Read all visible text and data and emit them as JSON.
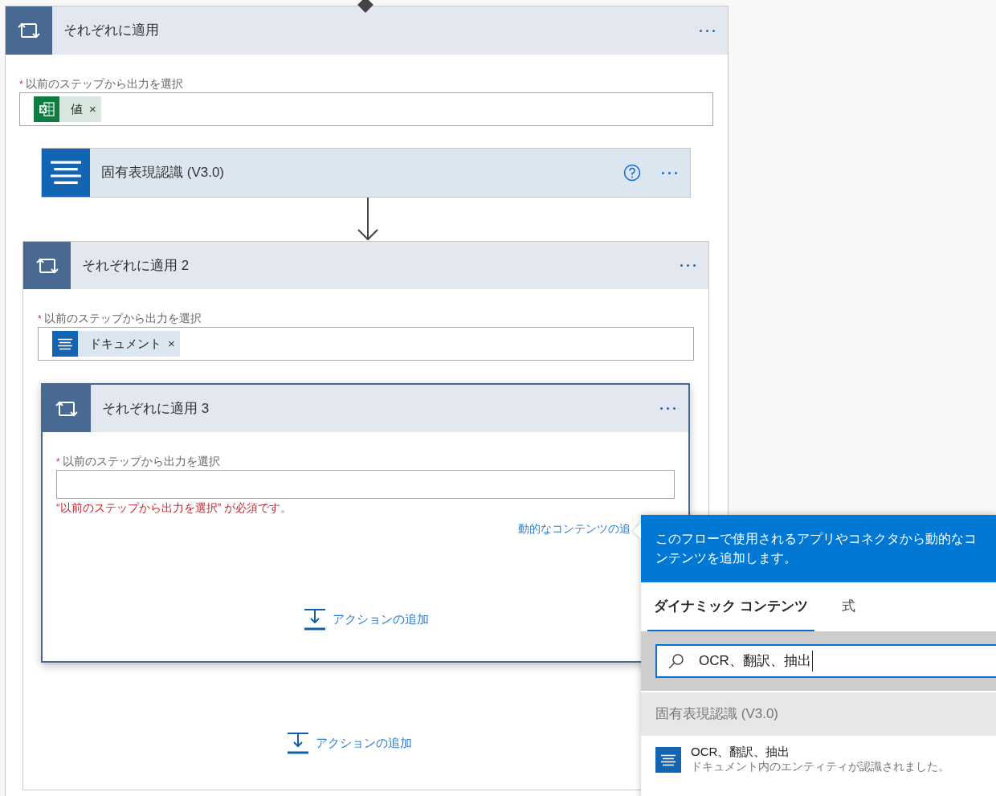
{
  "loop": {
    "title": "それぞれに適用",
    "field": {
      "required_mark": "*",
      "label": "以前のステップから出力を選択",
      "tokens": [
        {
          "kind": "excel",
          "label": "値",
          "remove": "×"
        }
      ]
    },
    "steps": [
      {
        "kind": "action",
        "title": "固有表現認識 (V3.0)"
      },
      {
        "kind": "loop",
        "title": "それぞれに適用 2",
        "field": {
          "required_mark": "*",
          "label": "以前のステップから出力を選択",
          "tokens": [
            {
              "kind": "text",
              "label": "ドキュメント",
              "remove": "×"
            }
          ]
        },
        "steps": [
          {
            "kind": "loop",
            "title": "それぞれに適用 3",
            "selected": true,
            "field": {
              "required_mark": "*",
              "label": "以前のステップから出力を選択",
              "error": "“以前のステップから出力を選択” が必須です。",
              "dynamic_link": "動的なコンテンツの追"
            },
            "add_action": "アクションの追加"
          }
        ],
        "add_action": "アクションの追加"
      }
    ]
  },
  "panel": {
    "description": "このフローで使用されるアプリやコネクタから動的なコンテンツを追加します。",
    "tabs": [
      {
        "label": "ダイナミック コンテンツ",
        "selected": true
      },
      {
        "label": "式",
        "selected": false
      }
    ],
    "search": {
      "value": "OCR、翻訳、抽出"
    },
    "groups": [
      {
        "title": "固有表現認識 (V3.0)",
        "items": [
          {
            "title": "OCR、翻訳、抽出",
            "subtitle": "ドキュメント内のエンティティが認識されました。"
          }
        ]
      }
    ]
  }
}
